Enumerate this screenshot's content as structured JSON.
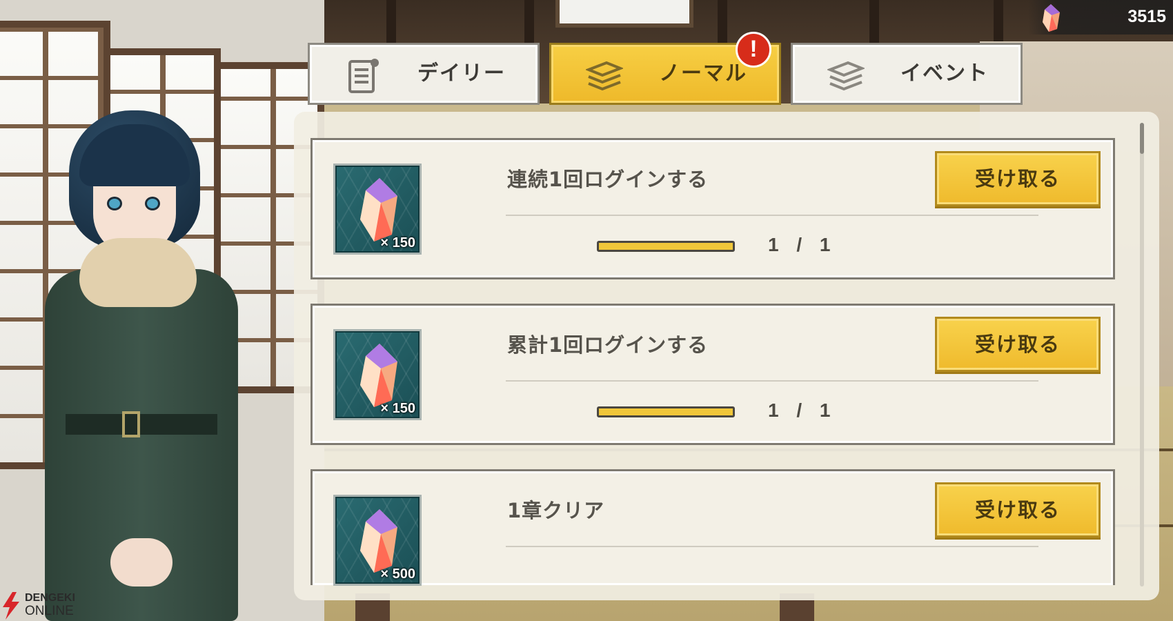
{
  "currency": {
    "amount": "3515",
    "icon": "crystal-icon"
  },
  "tabs": [
    {
      "label": "デイリー",
      "icon": "document-icon",
      "active": false
    },
    {
      "label": "ノーマル",
      "icon": "stack-icon",
      "active": true,
      "badge": "!"
    },
    {
      "label": "イベント",
      "icon": "stack-icon",
      "active": false
    }
  ],
  "missions": [
    {
      "title": "連続1回ログインする",
      "reward_qty": "× 150",
      "progress": "1 / 1",
      "progress_fraction": 1.0,
      "button": "受け取る"
    },
    {
      "title": "累計1回ログインする",
      "reward_qty": "× 150",
      "progress": "1 / 1",
      "progress_fraction": 1.0,
      "button": "受け取る"
    },
    {
      "title": "1章クリア",
      "reward_qty": "× 500",
      "button": "受け取る"
    }
  ],
  "watermark": {
    "line1": "DENGEKI",
    "line2": "ONLINE"
  },
  "colors": {
    "accent": "#f2c233",
    "badge": "#d72c1a",
    "reward_bg": "#1f5a60",
    "panel": "#f1eee2"
  }
}
